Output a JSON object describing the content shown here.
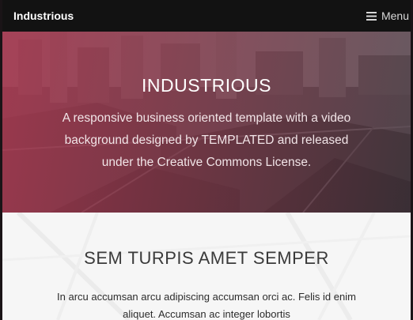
{
  "navbar": {
    "brand": "Industrious",
    "menu_label": "Menu",
    "menu_icon": "hamburger-icon"
  },
  "banner": {
    "title": "INDUSTRIOUS",
    "text": "A responsive business oriented template with a video background designed by TEMPLATED and released under the Creative Commons License."
  },
  "section": {
    "heading": "SEM TURPIS AMET SEMPER",
    "text": "In arcu accumsan arcu adipiscing accumsan orci ac. Felis id enim aliquet. Accumsan ac integer lobortis"
  },
  "colors": {
    "navbar_bg": "#121212",
    "accent": "#b2344e",
    "section_bg": "#f6f6f6"
  }
}
